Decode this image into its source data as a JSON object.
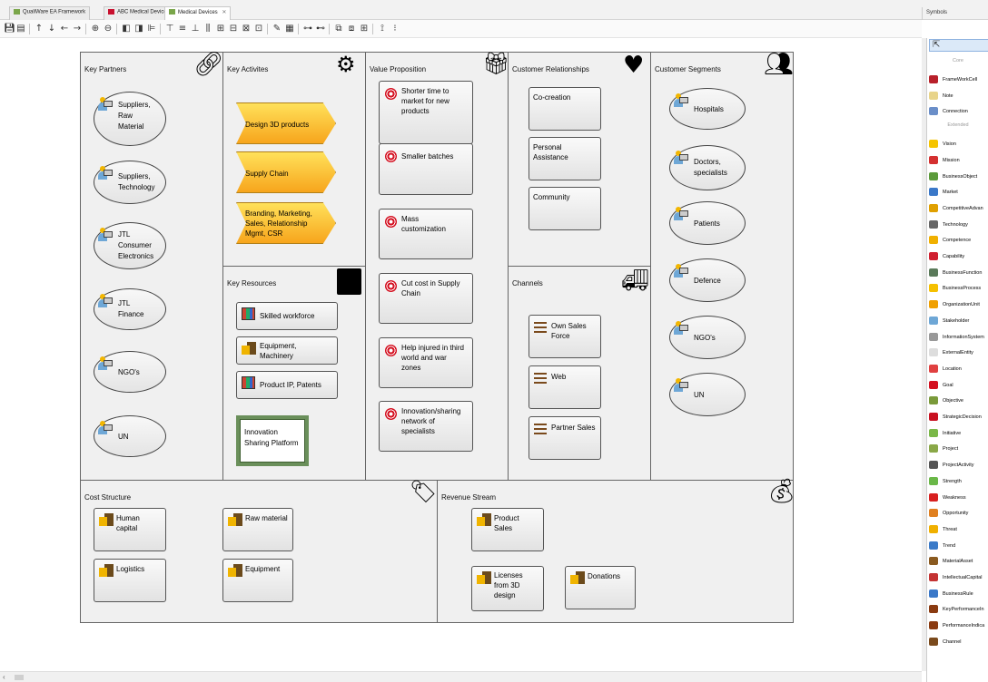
{
  "tabs": [
    {
      "label": "QualiWare EA Framework",
      "color": "#7aa64a"
    },
    {
      "label": "ABC Medical Devices",
      "color": "#c8102e"
    },
    {
      "label": "Medical Devices",
      "color": "#7aa64a",
      "active": true
    }
  ],
  "symbols_title": "Symbols",
  "canvas": {
    "sections": {
      "key_partners": "Key  Partners",
      "key_activities": "Key  Activites",
      "value_proposition": "Value  Proposition",
      "customer_relationships": "Customer  Relationships",
      "customer_segments": "Customer  Segments",
      "key_resources": "Key  Resources",
      "channels": "Channels",
      "cost_structure": "Cost  Structure",
      "revenue_stream": "Revenue  Stream"
    },
    "partners": [
      [
        "Suppliers,",
        "Raw",
        "Material"
      ],
      [
        "Suppliers,",
        "Technology"
      ],
      [
        "JTL",
        "Consumer",
        "Electronics"
      ],
      [
        "JTL",
        "Finance"
      ],
      [
        "NGO's"
      ],
      [
        "UN"
      ]
    ],
    "activities": [
      [
        "Design  3D  products"
      ],
      [
        "Supply  Chain"
      ],
      [
        "Branding,  Marketing,",
        "Sales,  Relationship",
        "Mgmt,  CSR"
      ]
    ],
    "resources": [
      {
        "lines": [
          "Skilled  workforce"
        ],
        "icon": "intellectual-capital"
      },
      {
        "lines": [
          "Equipment,",
          "Machinery"
        ],
        "icon": "material-asset"
      },
      {
        "lines": [
          "Product  IP,  Patents"
        ],
        "icon": "intellectual-capital"
      }
    ],
    "platform": [
      "Innovation",
      "Sharing  Platform"
    ],
    "value_props": [
      [
        "Shorter  time  to",
        "market  for  new",
        "products"
      ],
      [
        "Smaller  batches"
      ],
      [
        "Mass",
        "customization"
      ],
      [
        "Cut  cost  in  Supply",
        "Chain"
      ],
      [
        "Help  injured  in  third",
        "world  and  war",
        "zones"
      ],
      [
        "Innovation/sharing",
        "network  of",
        "specialists"
      ]
    ],
    "relationships": [
      [
        "Co-creation"
      ],
      [
        "Personal",
        "Assistance"
      ],
      [
        "Community"
      ]
    ],
    "channels": [
      [
        "Own  Sales",
        "Force"
      ],
      [
        "Web"
      ],
      [
        "Partner  Sales"
      ]
    ],
    "segments": [
      [
        "Hospitals"
      ],
      [
        "Doctors,",
        "specialists"
      ],
      [
        "Patients"
      ],
      [
        "Defence"
      ],
      [
        "NGO's"
      ],
      [
        "UN"
      ]
    ],
    "costs": [
      [
        "Human",
        "capital"
      ],
      [
        "Raw  material"
      ],
      [
        "Logistics"
      ],
      [
        "Equipment"
      ]
    ],
    "revenue": [
      [
        "Product",
        "Sales"
      ],
      [
        "Licenses",
        "from  3D",
        "design"
      ],
      [
        "Donations"
      ]
    ]
  },
  "palette": {
    "groups": [
      "Core",
      "Extended"
    ],
    "core_items": [
      {
        "label": "FrameWorkCell",
        "color": "#b8202a"
      },
      {
        "label": "Note",
        "color": "#e8d48a"
      },
      {
        "label": "Connection",
        "color": "#6a8ec8"
      }
    ],
    "extended_items": [
      {
        "label": "Vision",
        "color": "#f5c400"
      },
      {
        "label": "Mission",
        "color": "#d43030"
      },
      {
        "label": "BusinessObject",
        "color": "#5b9a3a"
      },
      {
        "label": "Market",
        "color": "#3a78c8"
      },
      {
        "label": "CompetitiveAdvan",
        "color": "#e0a000"
      },
      {
        "label": "Technology",
        "color": "#666666"
      },
      {
        "label": "Competence",
        "color": "#f0b000"
      },
      {
        "label": "Capability",
        "color": "#d02030"
      },
      {
        "label": "BusinessFunction",
        "color": "#5a7a5a"
      },
      {
        "label": "BusinessProcess",
        "color": "#f5c000"
      },
      {
        "label": "OrganizationUnit",
        "color": "#f0a000"
      },
      {
        "label": "Stakeholder",
        "color": "#6ea7d6"
      },
      {
        "label": "InformationSystem",
        "color": "#999999"
      },
      {
        "label": "ExternalEntity",
        "color": "#dddddd"
      },
      {
        "label": "Location",
        "color": "#e04040"
      },
      {
        "label": "Goal",
        "color": "#d41020"
      },
      {
        "label": "Objective",
        "color": "#7a9a3a"
      },
      {
        "label": "StrategicDecision",
        "color": "#c81020"
      },
      {
        "label": "Initiative",
        "color": "#7ab848"
      },
      {
        "label": "Project",
        "color": "#8aa848"
      },
      {
        "label": "ProjectActivity",
        "color": "#555555"
      },
      {
        "label": "Strength",
        "color": "#6ab848"
      },
      {
        "label": "Weakness",
        "color": "#d82020"
      },
      {
        "label": "Opportunity",
        "color": "#e08020"
      },
      {
        "label": "Threat",
        "color": "#f0b000"
      },
      {
        "label": "Trend",
        "color": "#3a7ac8"
      },
      {
        "label": "MaterialAsset",
        "color": "#8a5a20"
      },
      {
        "label": "IntellectualCapital",
        "color": "#c43333"
      },
      {
        "label": "BusinessRule",
        "color": "#3a78c8"
      },
      {
        "label": "KeyPerformanceIn",
        "color": "#8a3a10"
      },
      {
        "label": "PerformanceIndica",
        "color": "#8a3a10"
      },
      {
        "label": "Channel",
        "color": "#7a4a1c"
      }
    ]
  }
}
